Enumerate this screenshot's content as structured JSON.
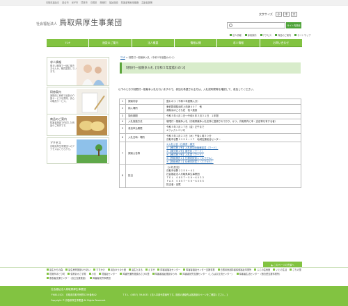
{
  "top_links": [
    "鳥取県福祉島",
    "鼻合市",
    "米子市",
    "境港市",
    "島根県",
    "斎館町",
    "福祉施設",
    "障害者等雇用機器",
    "高齢者施策"
  ],
  "header": {
    "org": "社会福祉法人",
    "name": "鳥取県厚生事業団",
    "font_label": "文字サイズ",
    "font_sizes": [
      "小",
      "中",
      "大"
    ],
    "search_placeholder": "",
    "search_button": "サイト内検索",
    "links": [
      "法人情報",
      "採用案内",
      "アクセス",
      "商品のご案内",
      "サイトマップ"
    ]
  },
  "nav": [
    "TOP",
    "施設のご案内",
    "法人概要",
    "情報公開",
    "求人情報",
    "お問い合わせ"
  ],
  "sidebar": [
    {
      "title": "求人情報",
      "desc": "明るい職場で一緒に働きませんか。職員募集しています。"
    },
    {
      "title": "研修案内",
      "desc": "実際的に研修で最新の介護サービスを習得。安心の職員サービス。"
    },
    {
      "title": "商品のご案内",
      "desc": "障害者施設で作成した商品のご案内です。"
    },
    {
      "title": "アクセス",
      "desc": "鳥取県厚生事業団へのアクセスはこちらから。"
    }
  ],
  "breadcrumb": {
    "home": "TOP",
    "sep": " > ",
    "current": "制限付一般競争入札（令和５年度藍わのつ）"
  },
  "title": "制限付一般競争入札【令和５年度藍わのつ】",
  "intro": "以下のとおり制限付一般競争入札を行いますので、参加を希望される方は、入札説明書等を確認して、参加してください。",
  "table": [
    {
      "n": "1",
      "k": "調達内容",
      "v": [
        "藍わのつ（令和５年度購入分）"
      ]
    },
    {
      "n": "2",
      "k": "納入場所",
      "v": [
        "東伯郡湯梨浜町上浅津４０７　他",
        "湯梨浜ほごろも荘　他３施設"
      ]
    },
    {
      "n": "3",
      "k": "契約期間",
      "v": [
        "令和５年４月１日～令和６年３月３１日　１年間"
      ]
    },
    {
      "n": "4",
      "k": "入札実施方法",
      "v": [
        "制限付一般競争入札（鳥取県競争入札名簿に登録されており、かつ、鳥取県内に本・支店等を有する者）"
      ]
    },
    {
      "n": "5",
      "k": "参加申込期限",
      "v": [
        "令和５年３月１７日（金）正午まで",
        "※ファクシミリ可"
      ]
    },
    {
      "n": "6",
      "k": "入札日時・場所",
      "v": [
        "令和５年２月２３日（木）午後１時３０分",
        "鳥取市伏野２２５９－１７　地域支援総合センター"
      ]
    },
    {
      "n": "7",
      "k": "調達公告等",
      "v": [
        "①入札公告・仕様書・様式",
        "②【様式第１号】入札参加資格確認書（ワード）",
        "③【様式第２号】委任状（ワード）",
        "④【様式第３号】入札書（ワード）",
        "⑤【別紙様式１】仕様内訳書１（エクセル）",
        "⑥【別紙様式２】仕様内訳書２（エクセル）"
      ]
    },
    {
      "n": "8",
      "k": "担当",
      "v": [
        "【入札担当】",
        "鳥取市伏野２２５９－４２",
        "社会福祉法人鳥取県厚生事業団",
        "ＴＥＬ　０８５７－５９－６０３３",
        "ＦＡＸ　０８５７－５９－６０５５",
        "担当者：島尾"
      ]
    }
  ],
  "to_top": "▲ このページの先頭へ",
  "footer_links": [
    "皆生からの森",
    "皆生療育施設ゆうあい",
    "すずかけ",
    "羽合ゆうゆう館",
    "皆生たまる",
    "えすが",
    "障害者福祉センター",
    "障害者福祉センター支援事業",
    "島根県東部障害保健福祉事業所",
    "ふじの芸術館",
    "いとの生活",
    "さちの里",
    "境港市ほとり町",
    "保育あかさず屋",
    "小鳥",
    "境福祉センター",
    "障害児通所施設あさひの里",
    "障害者福祉施設ゆうみ",
    "障害者就労支援センター（しらはま交流センター）",
    "障害者生活センター（宿泊型支援事業所）",
    "療養者支援センター（自立支援施設）",
    "障害者就労事業団"
  ],
  "footer": {
    "org": "社会福祉法人鳥取県厚生事業団",
    "addr": "〒680-0201　鳥取県鳥取市伏野2259番地42",
    "tel": "ＴＥＬ（0857）59-6033 【法人本部代表番号です。施設の連絡先は各施設のページをご確認ください。】",
    "copy": "Copyright © 鳥取県厚生事業団 All Rights Reserved."
  }
}
